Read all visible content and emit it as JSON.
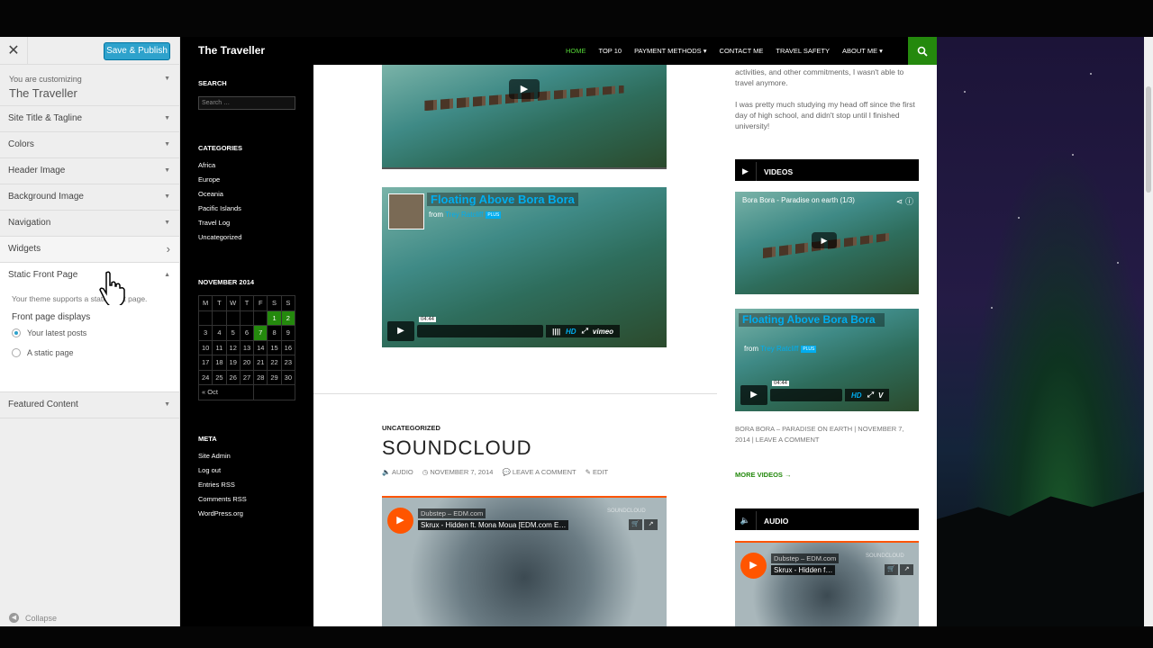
{
  "customizer": {
    "close_label": "✕",
    "save_label": "Save & Publish",
    "customizing_label": "You are customizing",
    "theme_name": "The Traveller",
    "sections": [
      {
        "label": "Site Title & Tagline"
      },
      {
        "label": "Colors"
      },
      {
        "label": "Header Image"
      },
      {
        "label": "Background Image"
      },
      {
        "label": "Navigation"
      },
      {
        "label": "Widgets"
      },
      {
        "label": "Static Front Page"
      },
      {
        "label": "Featured Content"
      }
    ],
    "static_front": {
      "description": "Your theme supports a static front page.",
      "displays_label": "Front page displays",
      "option_latest": "Your latest posts",
      "option_static": "A static page",
      "selected": "Your latest posts"
    },
    "collapse_label": "Collapse"
  },
  "site": {
    "title": "The Traveller",
    "nav": [
      "HOME",
      "TOP 10",
      "PAYMENT METHODS ▾",
      "CONTACT ME",
      "TRAVEL SAFETY",
      "ABOUT ME ▾"
    ],
    "search_icon": "search-icon"
  },
  "leftbar": {
    "search_title": "SEARCH",
    "search_placeholder": "Search …",
    "categories_title": "CATEGORIES",
    "categories": [
      "Africa",
      "Europe",
      "Oceania",
      "Pacific Islands",
      "Travel Log",
      "Uncategorized"
    ],
    "calendar_title": "NOVEMBER 2014",
    "calendar_head": [
      "M",
      "T",
      "W",
      "T",
      "F",
      "S",
      "S"
    ],
    "calendar_rows": [
      [
        "",
        "",
        "",
        "",
        "",
        "1",
        "2"
      ],
      [
        "3",
        "4",
        "5",
        "6",
        "7",
        "8",
        "9"
      ],
      [
        "10",
        "11",
        "12",
        "13",
        "14",
        "15",
        "16"
      ],
      [
        "17",
        "18",
        "19",
        "20",
        "21",
        "22",
        "23"
      ],
      [
        "24",
        "25",
        "26",
        "27",
        "28",
        "29",
        "30"
      ]
    ],
    "calendar_prev": "« Oct",
    "meta_title": "META",
    "meta_links": [
      "Site Admin",
      "Log out",
      "Entries RSS",
      "Comments RSS",
      "WordPress.org"
    ]
  },
  "content": {
    "vimeo": {
      "title": "Floating Above Bora Bora",
      "from": "from",
      "author": "Trey Ratcliff",
      "plus": "PLUS",
      "time": "04:44",
      "hd": "HD",
      "brand": "vimeo"
    },
    "post": {
      "category": "UNCATEGORIZED",
      "title": "SOUNDCLOUD",
      "meta": [
        "🔈 AUDIO",
        "◷ NOVEMBER 7, 2014",
        "💬 LEAVE A COMMENT",
        "✎ EDIT"
      ]
    },
    "soundcloud": {
      "user": "Dubstep – EDM.com",
      "track": "Skrux - Hidden ft. Mona Moua [EDM.com E…",
      "logo": "SOUNDCLOUD"
    }
  },
  "sidebar": {
    "text1": "activities, and other commitments, I wasn't able to travel anymore.",
    "text2": "I was pretty much studying my head off since the first day of high school, and didn't stop until I finished university!",
    "videos_title": "VIDEOS",
    "yt_title": "Bora Bora - Paradise on earth (1/3)",
    "vimeo_title": "Floating Above Bora Bora",
    "vimeo_from": "from",
    "vimeo_author": "Trey Ratcliff",
    "vimeo_plus": "PLUS",
    "vimeo_time": "04:44",
    "caption": "BORA BORA – PARADISE ON EARTH | NOVEMBER 7, 2014 | LEAVE A COMMENT",
    "more_videos": "MORE VIDEOS →",
    "audio_title": "AUDIO",
    "sc_user": "Dubstep – EDM.com",
    "sc_track": "Skrux - Hidden f…",
    "sc_logo": "SOUNDCLOUD"
  }
}
